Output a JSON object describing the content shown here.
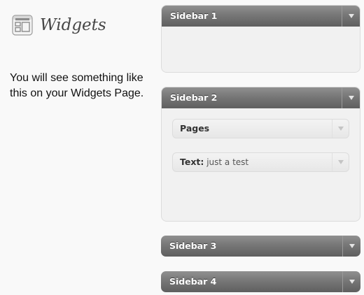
{
  "header": {
    "title": "Widgets",
    "icon": "widgets-icon"
  },
  "intro": {
    "text": "You will see something like this on your Widgets Page."
  },
  "sidebars": [
    {
      "title": "Sidebar 1",
      "expanded": true,
      "widgets": []
    },
    {
      "title": "Sidebar 2",
      "expanded": true,
      "widgets": [
        {
          "title": "Pages",
          "subtitle": ""
        },
        {
          "title": "Text",
          "separator": ":",
          "subtitle": " just a test"
        }
      ]
    },
    {
      "title": "Sidebar 3",
      "expanded": false,
      "widgets": []
    },
    {
      "title": "Sidebar 4",
      "expanded": false,
      "widgets": []
    }
  ],
  "colors": {
    "header_gradient_top": "#909090",
    "header_gradient_bottom": "#5f5f5f",
    "panel_bg": "#f1f1f1",
    "widget_bg": "#ececec",
    "title_text": "#464646"
  }
}
